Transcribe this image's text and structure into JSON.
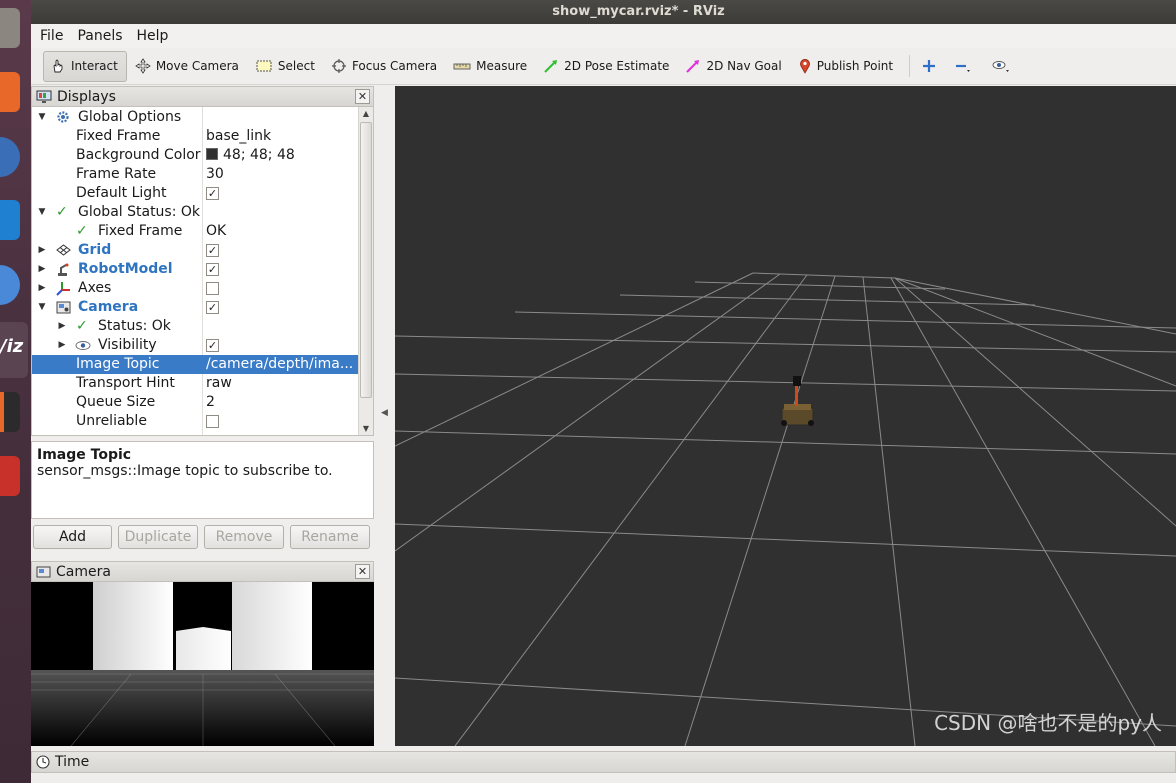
{
  "window": {
    "title": "show_mycar.rviz* - RViz"
  },
  "menu": [
    {
      "label": "File"
    },
    {
      "label": "Panels"
    },
    {
      "label": "Help"
    }
  ],
  "toolbar": {
    "tools": [
      {
        "label": "Interact",
        "icon": "hand-icon"
      },
      {
        "label": "Move Camera",
        "icon": "move-camera-icon"
      },
      {
        "label": "Select",
        "icon": "select-box-icon"
      },
      {
        "label": "Focus Camera",
        "icon": "focus-target-icon"
      },
      {
        "label": "Measure",
        "icon": "ruler-icon"
      },
      {
        "label": "2D Pose Estimate",
        "icon": "green-arrow-icon"
      },
      {
        "label": "2D Nav Goal",
        "icon": "magenta-arrow-icon"
      },
      {
        "label": "Publish Point",
        "icon": "map-pin-icon"
      }
    ]
  },
  "displays": {
    "title": "Displays",
    "rows": [
      {
        "name": "Global Options",
        "value": ""
      },
      {
        "name": "Fixed Frame",
        "value": "base_link"
      },
      {
        "name": "Background Color",
        "value": "48; 48; 48"
      },
      {
        "name": "Frame Rate",
        "value": "30"
      },
      {
        "name": "Default Light",
        "checked": true
      },
      {
        "name": "Global Status: Ok",
        "value": ""
      },
      {
        "name": "Fixed Frame",
        "value": "OK"
      },
      {
        "name": "Grid",
        "checked": true
      },
      {
        "name": "RobotModel",
        "checked": true
      },
      {
        "name": "Axes",
        "checked": false
      },
      {
        "name": "Camera",
        "checked": true
      },
      {
        "name": "Status: Ok",
        "value": ""
      },
      {
        "name": "Visibility",
        "checked": true
      },
      {
        "name": "Image Topic",
        "value": "/camera/depth/ima..."
      },
      {
        "name": "Transport Hint",
        "value": "raw"
      },
      {
        "name": "Queue Size",
        "value": "2"
      },
      {
        "name": "Unreliable",
        "checked": false
      }
    ],
    "description": {
      "title": "Image Topic",
      "text": "sensor_msgs::Image topic to subscribe to."
    },
    "buttons": [
      "Add",
      "Duplicate",
      "Remove",
      "Rename"
    ]
  },
  "camera_panel": {
    "title": "Camera"
  },
  "time_panel": {
    "title": "Time"
  },
  "watermark": "CSDN @啥也不是的py人",
  "colors": {
    "background": "#303030",
    "selection": "#3a7bc8",
    "display_name_blue": "#2f74c0"
  }
}
